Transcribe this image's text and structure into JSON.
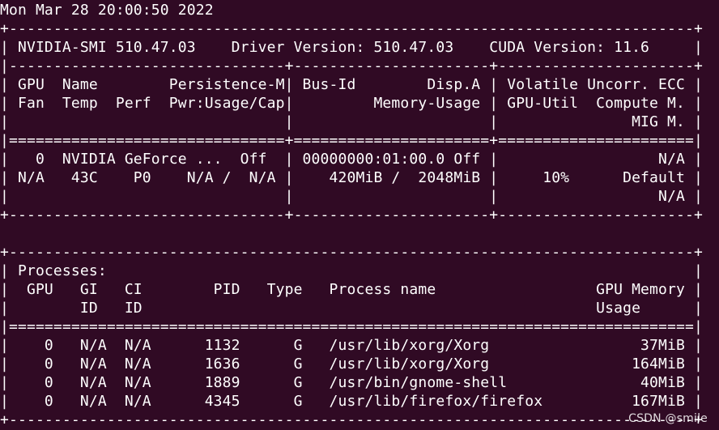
{
  "colors": {
    "background": "#300a24",
    "text": "#ffffff"
  },
  "terminal": {
    "lines": [
      "Mon Mar 28 20:00:50 2022",
      "+-----------------------------------------------------------------------------+",
      "| NVIDIA-SMI 510.47.03    Driver Version: 510.47.03    CUDA Version: 11.6     |",
      "|-------------------------------+----------------------+----------------------+",
      "| GPU  Name        Persistence-M| Bus-Id        Disp.A | Volatile Uncorr. ECC |",
      "| Fan  Temp  Perf  Pwr:Usage/Cap|         Memory-Usage | GPU-Util  Compute M. |",
      "|                               |                      |               MIG M. |",
      "|===============================+======================+======================|",
      "|   0  NVIDIA GeForce ...  Off  | 00000000:01:00.0 Off |                  N/A |",
      "| N/A   43C    P0    N/A /  N/A |    420MiB /  2048MiB |     10%      Default |",
      "|                               |                      |                  N/A |",
      "+-------------------------------+----------------------+----------------------+",
      "",
      "+-----------------------------------------------------------------------------+",
      "| Processes:                                                                  |",
      "|  GPU   GI   CI        PID   Type   Process name                  GPU Memory |",
      "|        ID   ID                                                   Usage      |",
      "|=============================================================================|",
      "|    0   N/A  N/A      1132      G   /usr/lib/xorg/Xorg                 37MiB |",
      "|    0   N/A  N/A      1636      G   /usr/lib/xorg/Xorg                164MiB |",
      "|    0   N/A  N/A      1889      G   /usr/bin/gnome-shell               40MiB |",
      "|    0   N/A  N/A      4345      G   /usr/lib/firefox/firefox          167MiB |",
      "+-----------------------------------------------------------------------------+"
    ]
  },
  "watermark": "CSDN @smile"
}
